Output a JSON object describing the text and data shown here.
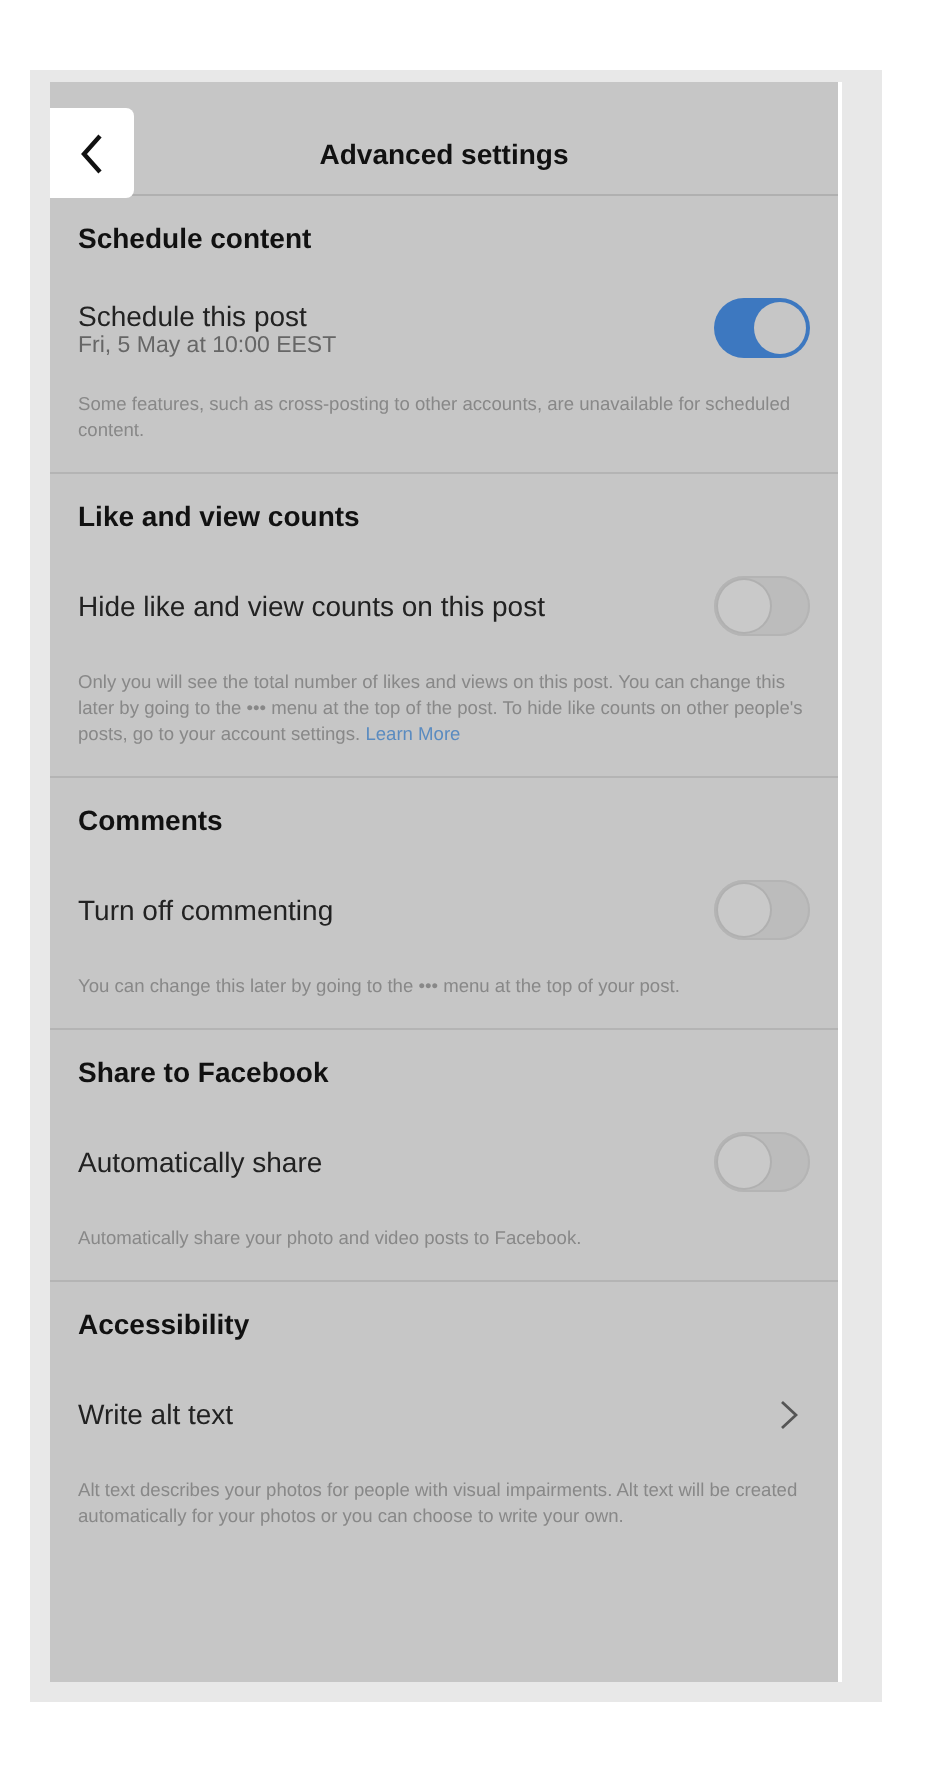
{
  "header": {
    "title": "Advanced settings"
  },
  "sections": [
    {
      "heading": "Schedule content",
      "kind": "toggle",
      "label": "Schedule this post",
      "sublabel": "Fri, 5 May at 10:00 EEST",
      "on": true,
      "note": "Some features, such as cross-posting to other accounts, are unavailable for scheduled content."
    },
    {
      "heading": "Like and view counts",
      "kind": "toggle",
      "label": "Hide like and view counts on this post",
      "on": false,
      "note": "Only you will see the total number of likes and views on this post. You can change this later by going to the ••• menu at the top of the post. To hide like counts on other people's posts, go to your account settings.",
      "link": "Learn More"
    },
    {
      "heading": "Comments",
      "kind": "toggle",
      "label": "Turn off commenting",
      "on": false,
      "note": "You can change this later by going to the ••• menu at the top of your post."
    },
    {
      "heading": "Share to Facebook",
      "kind": "toggle",
      "label": "Automatically share",
      "on": false,
      "note": "Automatically share your photo and video posts to Facebook."
    },
    {
      "heading": "Accessibility",
      "kind": "nav",
      "label": "Write alt text",
      "note": "Alt text describes your photos for people with visual impairments. Alt text will be created automatically for your photos or you can choose to write your own."
    }
  ]
}
